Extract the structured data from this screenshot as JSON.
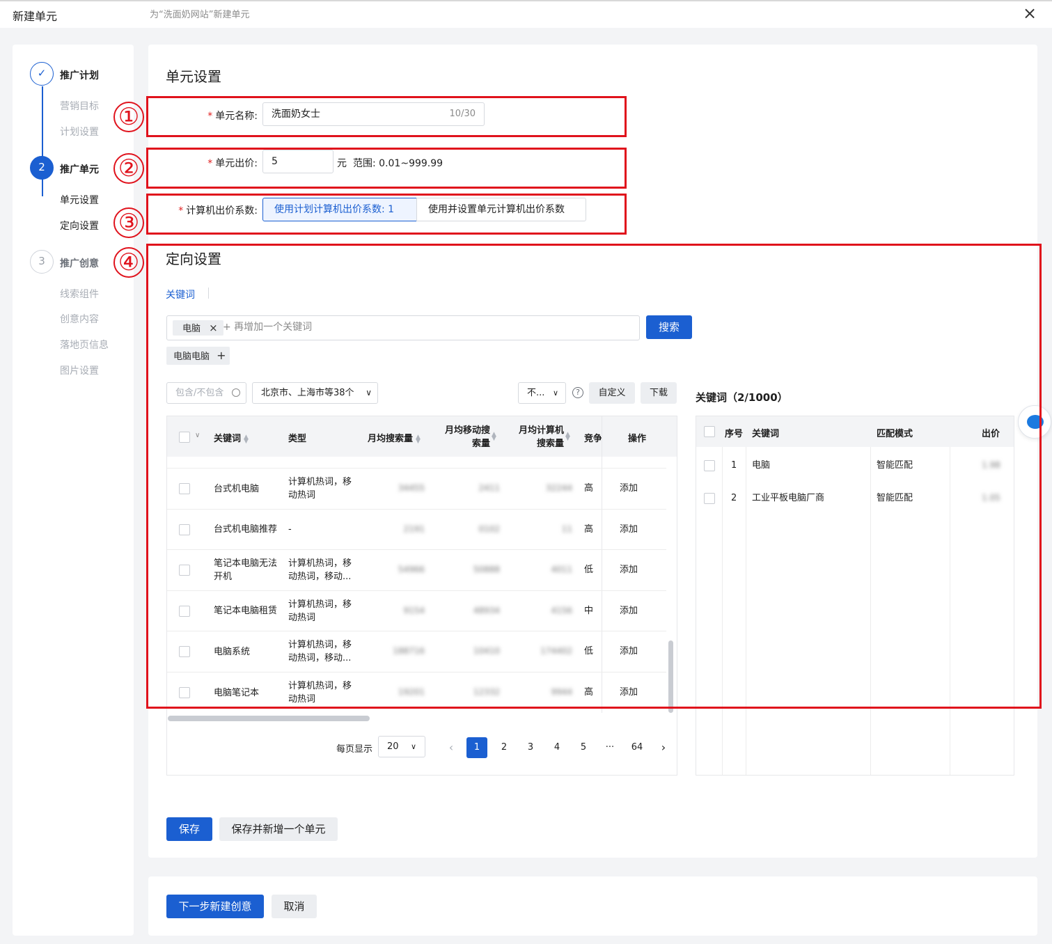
{
  "modal": {
    "title": "新建单元",
    "subtitle": "为“洗面奶网站”新建单元",
    "close_icon": "×"
  },
  "steps": [
    {
      "num": "✓",
      "title": "推广计划",
      "subs": [
        "营销目标",
        "计划设置"
      ]
    },
    {
      "num": "2",
      "title": "推广单元",
      "subs": [
        "单元设置",
        "定向设置"
      ]
    },
    {
      "num": "3",
      "title": "推广创意",
      "subs": [
        "线索组件",
        "创意内容",
        "落地页信息",
        "图片设置"
      ]
    }
  ],
  "unit": {
    "section_title": "单元设置",
    "name_label": "单元名称:",
    "name_value": "洗面奶女士",
    "name_count": "10/30",
    "bid_label": "单元出价:",
    "bid_value": "5",
    "bid_unit": "元",
    "bid_range": "范围: 0.01~999.99",
    "pc_label": "计算机出价系数:",
    "pc_opt1": "使用计划计算机出价系数: 1",
    "pc_opt2": "使用并设置单元计算机出价系数"
  },
  "annotations": [
    "①",
    "②",
    "③",
    "④"
  ],
  "targeting": {
    "section_title": "定向设置",
    "tab": "关键词",
    "tag": "电脑",
    "add_placeholder": "+ 再增加一个关键词",
    "search_btn": "搜索",
    "suggest_tag": "电脑电脑",
    "suggest_plus": "+",
    "filter_placeholder": "包含/不包含",
    "region": "北京市、上海市等38个",
    "device_select": "不...",
    "custom_btn": "自定义",
    "download_btn": "下载",
    "help_icon": "?",
    "right_title": "关键词（2/1000）"
  },
  "left_table": {
    "headers": [
      "关键词",
      "类型",
      "月均搜索量",
      "月均移动搜索量",
      "月均计算机搜索量",
      "竞争",
      "操作"
    ],
    "rows": [
      {
        "keyword": "台式机电脑",
        "type": "计算机热词，移动热词",
        "s1": "34455",
        "s2": "2411",
        "s3": "32244",
        "comp": "高",
        "action": "添加"
      },
      {
        "keyword": "台式机电脑推荐",
        "type": "-",
        "s1": "2191",
        "s2": "0102",
        "s3": "11",
        "comp": "高",
        "action": "添加"
      },
      {
        "keyword": "笔记本电脑无法开机",
        "type": "计算机热词，移动热词，移动...",
        "s1": "54966",
        "s2": "50888",
        "s3": "4011",
        "comp": "低",
        "action": "添加"
      },
      {
        "keyword": "笔记本电脑租赁",
        "type": "计算机热词，移动热词",
        "s1": "9154",
        "s2": "48934",
        "s3": "4156",
        "comp": "中",
        "action": "添加"
      },
      {
        "keyword": "电脑系统",
        "type": "计算机热词，移动热词，移动...",
        "s1": "188716",
        "s2": "10410",
        "s3": "174402",
        "comp": "低",
        "action": "添加"
      },
      {
        "keyword": "电脑笔记本",
        "type": "计算机热词，移动热词",
        "s1": "19201",
        "s2": "12332",
        "s3": "9944",
        "comp": "高",
        "action": "添加"
      }
    ]
  },
  "pagination": {
    "per_page_label": "每页显示",
    "per_page": "20",
    "prev_icon": "‹",
    "next_icon": "›",
    "pages": [
      "1",
      "2",
      "3",
      "4",
      "5",
      "···",
      "64"
    ]
  },
  "right_table": {
    "headers": [
      "序号",
      "关键词",
      "匹配模式",
      "出价"
    ],
    "rows": [
      {
        "idx": "1",
        "keyword": "电脑",
        "match": "智能匹配",
        "bid": "1.98"
      },
      {
        "idx": "2",
        "keyword": "工业平板电脑厂商",
        "match": "智能匹配",
        "bid": "1.05"
      }
    ]
  },
  "actions": {
    "save": "保存",
    "save_new": "保存并新增一个单元",
    "next": "下一步新建创意",
    "cancel": "取消"
  }
}
